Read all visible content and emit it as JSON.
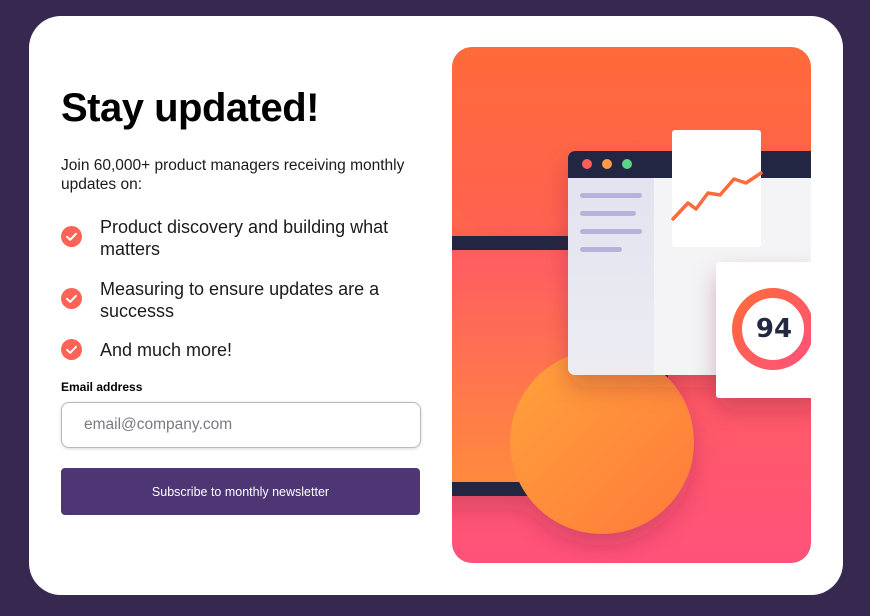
{
  "signup": {
    "title": "Stay updated!",
    "intro": "Join 60,000+ product managers receiving monthly updates on:",
    "benefits": [
      "Product discovery and building what matters",
      "Measuring to ensure updates are a successs",
      "And much more!"
    ],
    "email_label": "Email address",
    "email_placeholder": "email@company.com",
    "email_value": "",
    "subscribe_label": "Subscribe to monthly newsletter"
  },
  "illustration": {
    "score": "94"
  },
  "colors": {
    "background": "#36284f",
    "button": "#4e3675",
    "accent": "#ff6257",
    "gradient_top": "#ff6a3a",
    "gradient_bottom": "#ff527b",
    "dark_navy": "#242742"
  },
  "icons": {
    "check": "check-circle-icon"
  }
}
